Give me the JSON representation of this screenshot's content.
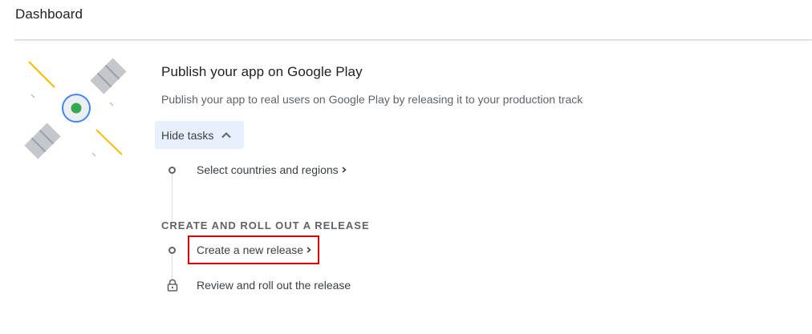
{
  "header": {
    "title": "Dashboard"
  },
  "card": {
    "title": "Publish your app on Google Play",
    "description": "Publish your app to real users on Google Play by releasing it to your production track",
    "hide_tasks_label": "Hide tasks"
  },
  "tasks": {
    "countries": "Select countries and regions",
    "section_heading": "CREATE AND ROLL OUT A RELEASE",
    "new_release": "Create a new release",
    "review_release": "Review and roll out the release"
  },
  "icons": {
    "illustration": "satellite-illustration",
    "collapse": "chevron-up-icon",
    "task_status": "circle-outline-icon",
    "locked": "lock-icon"
  },
  "colors": {
    "accent_bg": "#e8f0fe",
    "highlight": "#e00000",
    "satellite_blue": "#4285f4",
    "satellite_green": "#34a853",
    "ray_yellow": "#fbbc04"
  }
}
